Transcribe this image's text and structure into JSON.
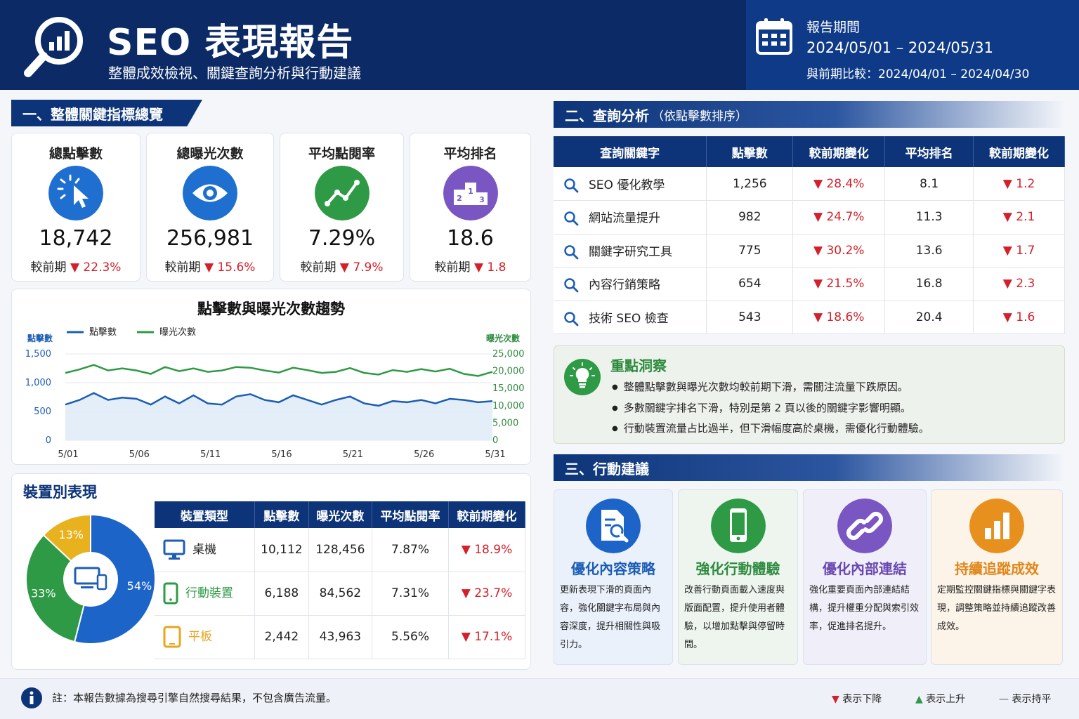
{
  "header": {
    "title": "SEO 表現報告",
    "subtitle": "整體成效檢視、關鍵查詢分析與行動建議",
    "report_period_label": "報告期間",
    "report_period": "2024/05/01 – 2024/05/31",
    "compare_period": "與前期比較：2024/04/01 – 2024/04/30"
  },
  "section1": {
    "title": "一、整體關鍵指標總覽"
  },
  "kpis": [
    {
      "label": "總點擊數",
      "value": "18,742",
      "prev_label": "較前期",
      "change": "▼ 22.3%",
      "icon": "cursor-click-icon",
      "color": "#1e6fd0"
    },
    {
      "label": "總曝光次數",
      "value": "256,981",
      "prev_label": "較前期",
      "change": "▼ 15.6%",
      "icon": "eye-icon",
      "color": "#1e6fd0"
    },
    {
      "label": "平均點閱率",
      "value": "7.29%",
      "prev_label": "較前期",
      "change": "▼ 7.9%",
      "icon": "trend-line-icon",
      "color": "#2e9a45"
    },
    {
      "label": "平均排名",
      "value": "18.6",
      "prev_label": "較前期",
      "change": "▼ 1.8",
      "icon": "podium-icon",
      "color": "#7a56c2"
    }
  ],
  "chart_data": {
    "type": "line",
    "title": "點擊數與曝光次數趨勢",
    "x_ticks": [
      "5/01",
      "5/06",
      "5/11",
      "5/16",
      "5/21",
      "5/26",
      "5/31"
    ],
    "x": [
      1,
      2,
      3,
      4,
      5,
      6,
      7,
      8,
      9,
      10,
      11,
      12,
      13,
      14,
      15,
      16,
      17,
      18,
      19,
      20,
      21,
      22,
      23,
      24,
      25,
      26,
      27,
      28,
      29,
      30,
      31
    ],
    "ylabel_left": "點擊數",
    "ylabel_right": "曝光次數",
    "ylim_left": [
      0,
      1500
    ],
    "ylim_right": [
      0,
      25000
    ],
    "yticks_left": [
      "1,500",
      "1,000",
      "500",
      "0"
    ],
    "yticks_right": [
      "25,000",
      "20,000",
      "15,000",
      "10,000",
      "5,000",
      "0"
    ],
    "legend_position": "top-left",
    "series": [
      {
        "name": "點擊數",
        "axis": "left",
        "color": "#1c5db5",
        "values": [
          620,
          700,
          820,
          700,
          740,
          720,
          620,
          760,
          640,
          780,
          640,
          620,
          760,
          800,
          700,
          660,
          780,
          700,
          620,
          700,
          760,
          640,
          600,
          680,
          660,
          700,
          640,
          720,
          700,
          660,
          680
        ]
      },
      {
        "name": "曝光次數",
        "axis": "right",
        "color": "#2e9a45",
        "values": [
          19500,
          20500,
          21800,
          20200,
          20800,
          20200,
          19200,
          21200,
          20000,
          20800,
          19800,
          20200,
          21200,
          21000,
          20200,
          19600,
          21000,
          20300,
          19500,
          19800,
          20900,
          19500,
          19000,
          20300,
          19800,
          20600,
          19900,
          20700,
          19200,
          18600,
          19800
        ]
      }
    ]
  },
  "device": {
    "title": "裝置別表現",
    "pie": [
      {
        "name": "桌機",
        "percent": 54,
        "label": "54%",
        "color": "#1c64c8"
      },
      {
        "name": "行動裝置",
        "percent": 33,
        "label": "33%",
        "color": "#2e9a45"
      },
      {
        "name": "平板",
        "percent": 13,
        "label": "13%",
        "color": "#e8b21e"
      }
    ],
    "headers": [
      "裝置類型",
      "點擊數",
      "曝光次數",
      "平均點閱率",
      "較前期變化"
    ],
    "rows": [
      {
        "device": "桌機",
        "clicks": "10,112",
        "impressions": "128,456",
        "ctr": "7.87%",
        "change": "▼ 18.9%",
        "color": "#1c5db5"
      },
      {
        "device": "行動裝置",
        "clicks": "6,188",
        "impressions": "84,562",
        "ctr": "7.31%",
        "change": "▼ 23.7%",
        "color": "#2e9a45"
      },
      {
        "device": "平板",
        "clicks": "2,442",
        "impressions": "43,963",
        "ctr": "5.56%",
        "change": "▼ 17.1%",
        "color": "#e8a51e"
      }
    ]
  },
  "section2": {
    "title": "二、查詢分析",
    "subtitle": "（依點擊數排序）"
  },
  "queries": {
    "headers": [
      "查詢關鍵字",
      "點擊數",
      "較前期變化",
      "平均排名",
      "較前期變化"
    ],
    "rows": [
      {
        "keyword": "SEO 優化教學",
        "clicks": "1,256",
        "change": "▼ 28.4%",
        "rank": "8.1",
        "rank_change": "▼ 1.2"
      },
      {
        "keyword": "網站流量提升",
        "clicks": "982",
        "change": "▼ 24.7%",
        "rank": "11.3",
        "rank_change": "▼ 2.1"
      },
      {
        "keyword": "關鍵字研究工具",
        "clicks": "775",
        "change": "▼ 30.2%",
        "rank": "13.6",
        "rank_change": "▼ 1.7"
      },
      {
        "keyword": "內容行銷策略",
        "clicks": "654",
        "change": "▼ 21.5%",
        "rank": "16.8",
        "rank_change": "▼ 2.3"
      },
      {
        "keyword": "技術 SEO 檢查",
        "clicks": "543",
        "change": "▼ 18.6%",
        "rank": "20.4",
        "rank_change": "▼ 1.6"
      }
    ]
  },
  "insight": {
    "title": "重點洞察",
    "items": [
      "整體點擊數與曝光次數均較前期下滑，需關注流量下跌原因。",
      "多數關鍵字排名下滑，特別是第 2 頁以後的關鍵字影響明顯。",
      "行動裝置流量占比過半，但下滑幅度高於桌機，需優化行動體驗。"
    ]
  },
  "section3": {
    "title": "三、行動建議"
  },
  "actions": [
    {
      "title": "優化內容策略",
      "text": "更新表現下滑的頁面內容，強化關鍵字布局與內容深度，提升相關性與吸引力。",
      "color": "#1c64c8",
      "bg": "#eaf1fb",
      "icon": "document-search-icon"
    },
    {
      "title": "強化行動體驗",
      "text": "改善行動頁面載入速度與版面配置，提升使用者體驗，以增加點擊與停留時間。",
      "color": "#2e9a45",
      "bg": "#edf5ee",
      "icon": "mobile-phone-icon"
    },
    {
      "title": "優化內部連結",
      "text": "強化重要頁面內部連結結構，提升權重分配與索引效率，促進排名提升。",
      "color": "#7a56c2",
      "bg": "#f0eef8",
      "icon": "link-icon"
    },
    {
      "title": "持續追蹤成效",
      "text": "定期監控關鍵指標與關鍵字表現，調整策略並持續追蹤改善成效。",
      "color": "#e8901e",
      "bg": "#fcf4e8",
      "icon": "bar-chart-icon"
    }
  ],
  "footer": {
    "note": "註：本報告數據為搜尋引擎自然搜尋結果，不包含廣告流量。",
    "legend_down": "表示下降",
    "legend_up": "表示上升",
    "legend_flat": "表示持平",
    "colors": {
      "down": "#d3202a",
      "up": "#2e9a45",
      "flat": "#666666"
    }
  }
}
